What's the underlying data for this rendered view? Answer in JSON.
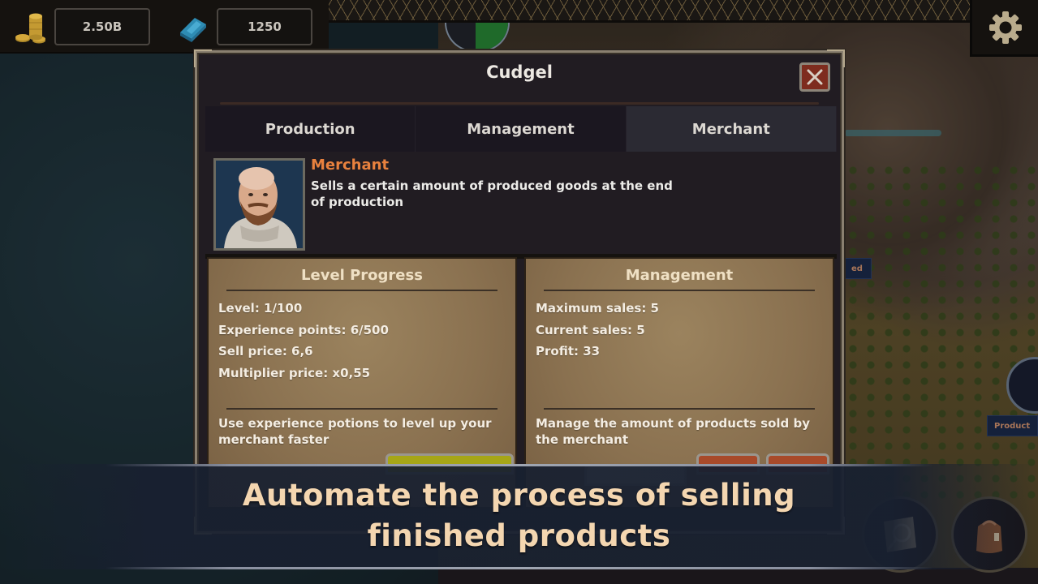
{
  "hud": {
    "gold_value": "2.50B",
    "gems_value": "1250",
    "gold_icon": "coin-stack-icon",
    "gems_icon": "gem-book-icon",
    "settings_icon": "gear-icon"
  },
  "map": {
    "ribbon_partial_left": "ed",
    "ribbon_partial_right": "Product"
  },
  "dialog": {
    "title": "Cudgel",
    "close_icon": "close-icon",
    "tabs": [
      {
        "label": "Production",
        "active": false
      },
      {
        "label": "Management",
        "active": false
      },
      {
        "label": "Merchant",
        "active": true
      }
    ],
    "merchant": {
      "name": "Merchant",
      "description": "Sells a certain amount of produced goods at the end of production"
    },
    "level_panel": {
      "title": "Level Progress",
      "lines": [
        "Level: 1/100",
        "Experience points: 6/500",
        "Sell price: 6,6",
        "Multiplier price: x0,55"
      ],
      "hint": "Use experience potions to level up your merchant faster"
    },
    "management_panel": {
      "title": "Management",
      "lines": [
        "Maximum sales: 5",
        "Current sales: 5",
        "Profit: 33"
      ],
      "hint": "Manage the amount of products sold by the merchant"
    }
  },
  "caption": {
    "line1": "Automate the process of selling",
    "line2": "finished products"
  },
  "bottom_buttons": [
    {
      "icon": "map-search-icon"
    },
    {
      "icon": "backpack-icon"
    }
  ],
  "colors": {
    "accent_orange": "#e8813e",
    "caption_text": "#f4d6b0",
    "close_button": "#7e2c1e",
    "level_up_button": "#a6a617",
    "adjust_buttons": "#a84a2a"
  }
}
